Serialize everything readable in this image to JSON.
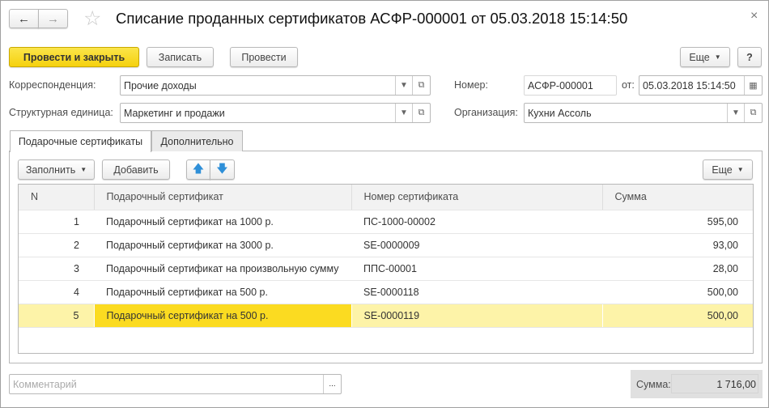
{
  "window": {
    "title": "Списание проданных сертификатов АСФР-000001 от 05.03.2018 15:14:50",
    "close": "×"
  },
  "toolbar": {
    "post_close": "Провести и закрыть",
    "save": "Записать",
    "post": "Провести",
    "more": "Еще",
    "help": "?"
  },
  "fields": {
    "corr_label": "Корреспонденция:",
    "corr_value": "Прочие доходы",
    "unit_label": "Структурная единица:",
    "unit_value": "Маркетинг и продажи",
    "number_label": "Номер:",
    "number_value": "АСФР-000001",
    "date_label": "от:",
    "date_value": "05.03.2018 15:14:50",
    "org_label": "Организация:",
    "org_value": "Кухни Ассоль"
  },
  "tabs": [
    {
      "label": "Подарочные сертификаты",
      "active": true
    },
    {
      "label": "Дополнительно",
      "active": false
    }
  ],
  "table_toolbar": {
    "fill": "Заполнить",
    "add": "Добавить",
    "more": "Еще"
  },
  "table": {
    "columns": [
      "N",
      "Подарочный сертификат",
      "Номер сертификата",
      "Сумма"
    ],
    "rows": [
      {
        "n": "1",
        "cert": "Подарочный сертификат на 1000 р.",
        "num": "ПС-1000-00002",
        "sum": "595,00"
      },
      {
        "n": "2",
        "cert": "Подарочный сертификат на 3000 р.",
        "num": "SE-0000009",
        "sum": "93,00"
      },
      {
        "n": "3",
        "cert": "Подарочный сертификат на произвольную сумму",
        "num": "ППС-00001",
        "sum": "28,00"
      },
      {
        "n": "4",
        "cert": "Подарочный сертификат на 500 р.",
        "num": "SE-0000118",
        "sum": "500,00"
      },
      {
        "n": "5",
        "cert": "Подарочный сертификат на 500 р.",
        "num": "SE-0000119",
        "sum": "500,00"
      }
    ],
    "selected_row": 5
  },
  "footer": {
    "comment_placeholder": "Комментарий",
    "comment_button": "...",
    "sum_label": "Сумма:",
    "sum_value": "1 716,00"
  }
}
